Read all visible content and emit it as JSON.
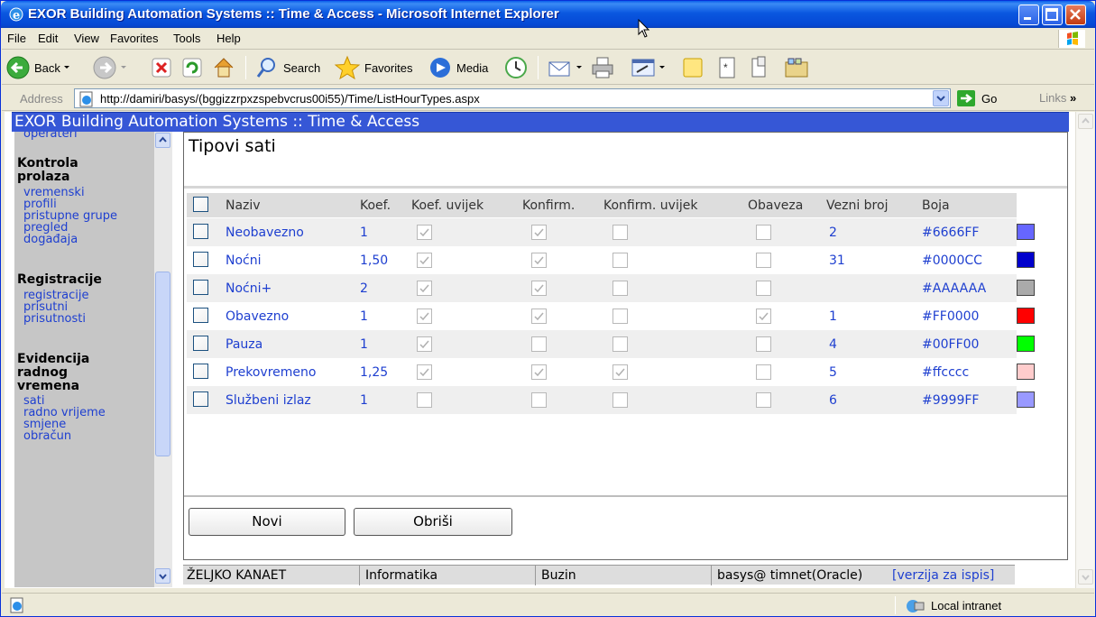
{
  "window": {
    "title": "EXOR Building Automation Systems :: Time & Access - Microsoft Internet Explorer"
  },
  "menu": [
    "File",
    "Edit",
    "View",
    "Favorites",
    "Tools",
    "Help"
  ],
  "toolbar": {
    "back": "Back",
    "search": "Search",
    "favorites": "Favorites",
    "media": "Media"
  },
  "address": {
    "label": "Address",
    "url": "http://damiri/basys/(bggizzrpxzspebvcrus00i55)/Time/ListHourTypes.aspx",
    "go": "Go",
    "links": "Links"
  },
  "app": {
    "header": "EXOR Building Automation Systems :: Time & Access"
  },
  "nav": {
    "top_link": "operateri",
    "groups": [
      {
        "title_lines": [
          "Kontrola",
          "prolaza"
        ],
        "links": [
          "vremenski",
          "profili",
          "pristupne grupe",
          "pregled",
          "događaja"
        ]
      },
      {
        "title_lines": [
          "Registracije"
        ],
        "links": [
          "registracije",
          "prisutni",
          "prisutnosti"
        ]
      },
      {
        "title_lines": [
          "Evidencija",
          "radnog",
          "vremena"
        ],
        "links": [
          "sati",
          "radno vrijeme",
          "smjene",
          "obračun"
        ]
      }
    ]
  },
  "page": {
    "title": "Tipovi sati",
    "columns": [
      "Naziv",
      "Koef.",
      "Koef. uvijek",
      "Konfirm.",
      "Konfirm. uvijek",
      "Obaveza",
      "Vezni broj",
      "Boja"
    ],
    "rows": [
      {
        "naziv": "Neobavezno",
        "koef": "1",
        "koef_uvijek": true,
        "konfirm": true,
        "konfirm_uvijek": false,
        "obaveza": false,
        "vezni": "2",
        "boja": "#6666FF",
        "swatch": "#6666FF"
      },
      {
        "naziv": "Noćni",
        "koef": "1,50",
        "koef_uvijek": true,
        "konfirm": true,
        "konfirm_uvijek": false,
        "obaveza": false,
        "vezni": "31",
        "boja": "#0000CC",
        "swatch": "#0000CC"
      },
      {
        "naziv": "Noćni+",
        "koef": "2",
        "koef_uvijek": true,
        "konfirm": true,
        "konfirm_uvijek": false,
        "obaveza": false,
        "vezni": "",
        "boja": "#AAAAAA",
        "swatch": "#AAAAAA"
      },
      {
        "naziv": "Obavezno",
        "koef": "1",
        "koef_uvijek": true,
        "konfirm": true,
        "konfirm_uvijek": false,
        "obaveza": true,
        "vezni": "1",
        "boja": "#FF0000",
        "swatch": "#FF0000"
      },
      {
        "naziv": "Pauza",
        "koef": "1",
        "koef_uvijek": true,
        "konfirm": false,
        "konfirm_uvijek": false,
        "obaveza": false,
        "vezni": "4",
        "boja": "#00FF00",
        "swatch": "#00FF00"
      },
      {
        "naziv": "Prekovremeno",
        "koef": "1,25",
        "koef_uvijek": true,
        "konfirm": true,
        "konfirm_uvijek": true,
        "obaveza": false,
        "vezni": "5",
        "boja": "#ffcccc",
        "swatch": "#FFCCCC"
      },
      {
        "naziv": "Službeni izlaz",
        "koef": "1",
        "koef_uvijek": false,
        "konfirm": false,
        "konfirm_uvijek": false,
        "obaveza": false,
        "vezni": "6",
        "boja": "#9999FF",
        "swatch": "#9999FF"
      }
    ],
    "buttons": {
      "new": "Novi",
      "delete": "Obriši"
    }
  },
  "footer": {
    "user": "ŽELJKO KANAET",
    "dept": "Informatika",
    "location": "Buzin",
    "db": "basys@ timnet(Oracle)",
    "print_link": "[verzija za ispis]"
  },
  "statusbar": {
    "zone": "Local intranet"
  }
}
